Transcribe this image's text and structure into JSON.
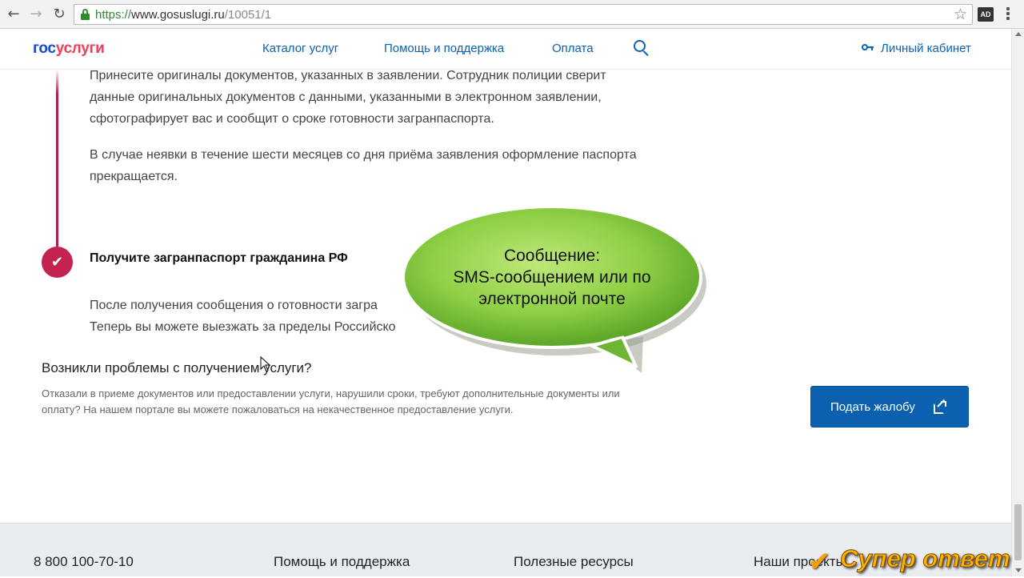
{
  "browser": {
    "url_scheme": "https://",
    "url_host": "www.gosuslugi.ru",
    "url_path": "/10051/1",
    "extension_label": "AD"
  },
  "header": {
    "logo_part1": "гос",
    "logo_part2": "услуги",
    "nav": {
      "catalog": "Каталог услуг",
      "help": "Помощь и поддержка",
      "payment": "Оплата"
    },
    "cabinet": "Личный кабинет"
  },
  "content": {
    "para1": "Принесите оригиналы документов, указанных в заявлении. Сотрудник полиции сверит данные оригинальных документов с данными, указанными в электронном заявлении, сфотографирует вас и сообщит о сроке готовности загранпаспорта.",
    "para2": "В случае неявки в течение шести месяцев со дня приёма заявления оформление паспорта прекращается.",
    "step_title": "Получите загранпаспорт гражданина РФ",
    "para3_line1": "После получения сообщения о готовности загра",
    "para3_line2": "Теперь вы можете выезжать за пределы Российско"
  },
  "problems": {
    "title": "Возникли проблемы с получением услуги?",
    "text": "Отказали в приеме документов или предоставлении услуги, нарушили сроки, требуют дополнительные документы или оплату? На нашем портале вы можете пожаловаться на некачественное предоставление услуги.",
    "button": "Подать жалобу"
  },
  "footer": {
    "phone": "8 800 100-70-10",
    "help": "Помощь и поддержка",
    "resources": "Полезные ресурсы",
    "projects": "Наши проекты"
  },
  "overlay": {
    "line1": "Сообщение:",
    "line2": "SMS-сообщением или по",
    "line3": "электронной почте",
    "bubble_color": "#7cc43a"
  },
  "watermark": {
    "text": "Супер ответ"
  },
  "colors": {
    "link": "#0b61b4",
    "accent": "#c4234f",
    "button": "#0b60b0"
  }
}
